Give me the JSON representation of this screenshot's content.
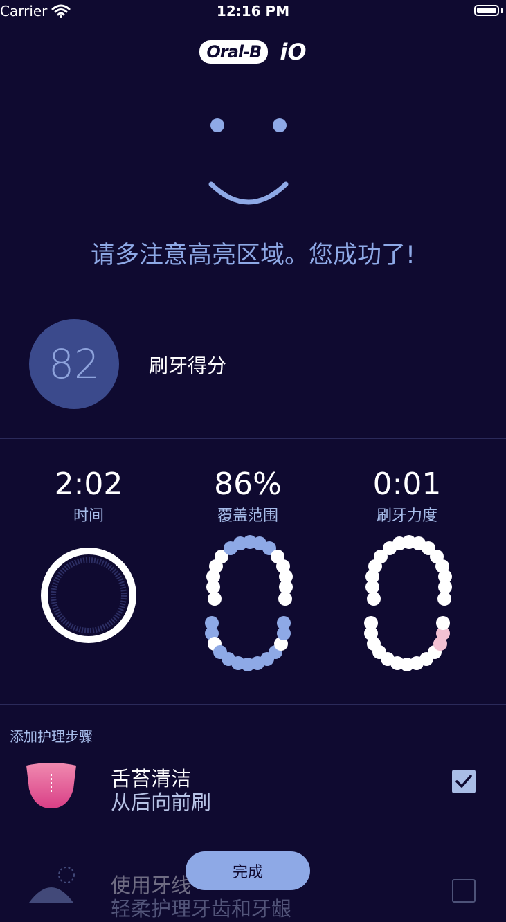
{
  "status_bar": {
    "carrier": "Carrier",
    "time": "12:16 PM"
  },
  "brand": {
    "name": "Oral-B",
    "product": "iO"
  },
  "headline": "请多注意高亮区域。您成功了!",
  "score": {
    "value": "82",
    "label": "刷牙得分"
  },
  "stats": [
    {
      "value": "2:02",
      "label": "时间"
    },
    {
      "value": "86%",
      "label": "覆盖范围"
    },
    {
      "value": "0:01",
      "label": "刷牙力度"
    }
  ],
  "care": {
    "title": "添加护理步骤",
    "items": [
      {
        "name": "舌苔清洁",
        "desc": "从后向前刷",
        "checked": true
      },
      {
        "name": "使用牙线",
        "desc": "轻柔护理牙齿和牙龈",
        "checked": false
      }
    ]
  },
  "done_label": "完成",
  "colors": {
    "background": "#0f0a30",
    "accent": "#8ea9e6",
    "score_circle": "#3b4a8c",
    "pressure": "#f3c1d3",
    "tongue": "#e85a94"
  }
}
